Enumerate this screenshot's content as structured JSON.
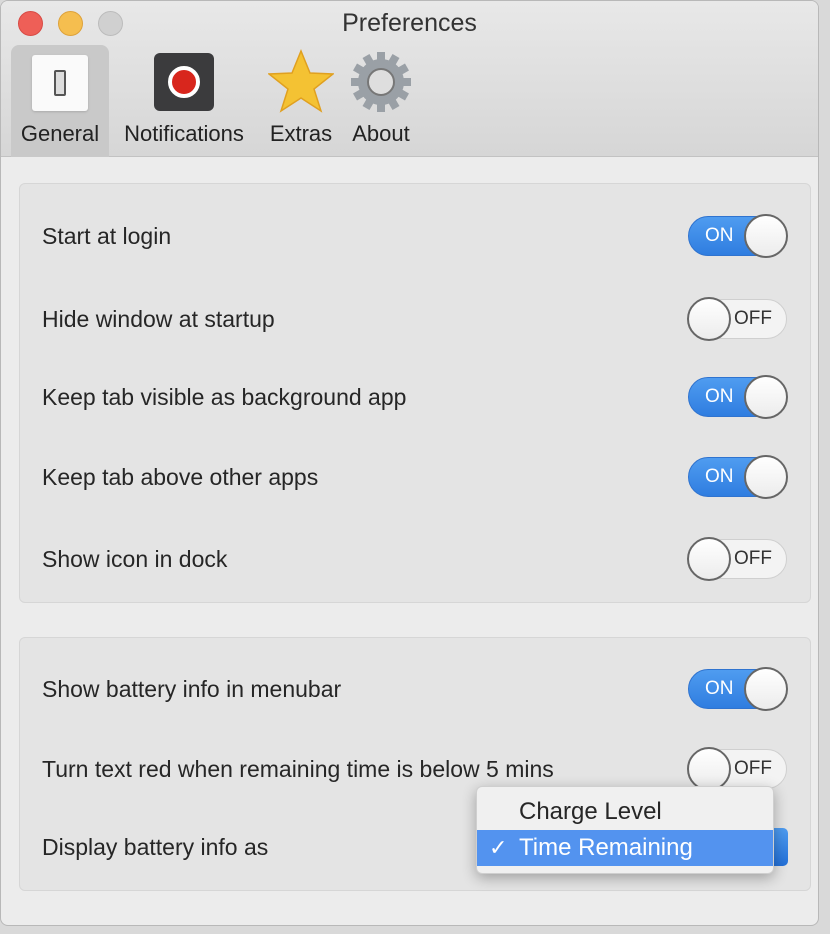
{
  "window": {
    "title": "Preferences"
  },
  "tabs": [
    {
      "label": "General",
      "icon": "switch-icon",
      "selected": true
    },
    {
      "label": "Notifications",
      "icon": "record-icon"
    },
    {
      "label": "Extras",
      "icon": "star-icon"
    },
    {
      "label": "About",
      "icon": "gear-icon"
    }
  ],
  "general": [
    {
      "label": "Start at login",
      "state": "ON"
    },
    {
      "label": "Hide window at startup",
      "state": "OFF"
    },
    {
      "label": "Keep tab visible as background app",
      "state": "ON"
    },
    {
      "label": "Keep tab above other apps",
      "state": "ON"
    },
    {
      "label": "Show icon in dock",
      "state": "OFF"
    }
  ],
  "battery": [
    {
      "label": "Show battery info in menubar",
      "state": "ON"
    },
    {
      "label": "Turn text red when remaining time is below 5 mins",
      "state": "OFF"
    }
  ],
  "display": {
    "label": "Display battery info as",
    "options": [
      "Charge Level",
      "Time Remaining"
    ],
    "selected": "Time Remaining",
    "check": "✓"
  },
  "colors": {
    "accent": "#2f7de0",
    "close": "#ee5f57",
    "minimize": "#f5be4f"
  }
}
